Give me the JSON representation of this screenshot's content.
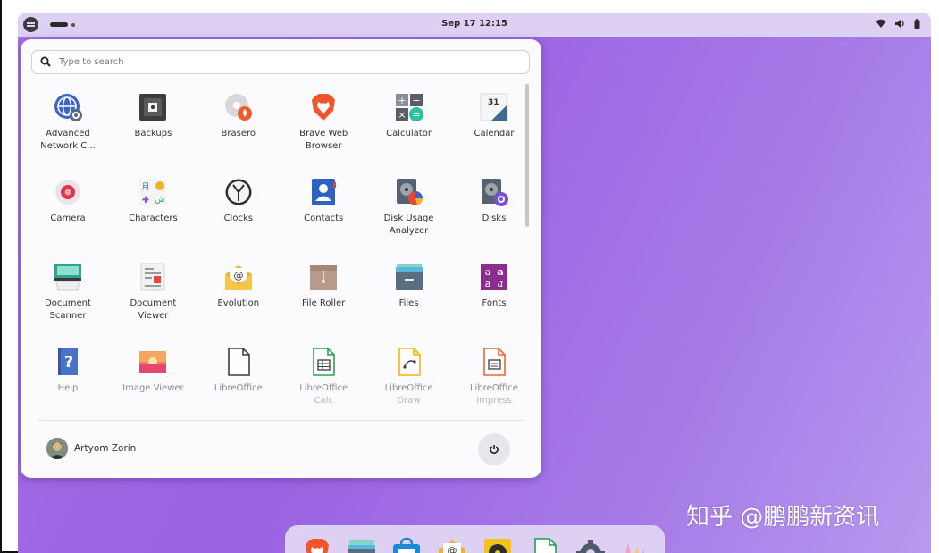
{
  "topbar": {
    "clock": "Sep 17  12:15",
    "workspaces": {
      "active": 1,
      "count": 2
    },
    "tray_icons": [
      "wifi-icon",
      "volume-icon",
      "battery-icon"
    ]
  },
  "menu": {
    "search_placeholder": "Type to search",
    "apps": [
      {
        "name": "Advanced",
        "sub": "Network C...",
        "icon": "network-settings-icon",
        "faded": false
      },
      {
        "name": "Backups",
        "sub": "",
        "icon": "backups-icon",
        "faded": false
      },
      {
        "name": "Brasero",
        "sub": "",
        "icon": "disc-burner-icon",
        "faded": false
      },
      {
        "name": "Brave Web",
        "sub": "Browser",
        "icon": "brave-lion-icon",
        "faded": false
      },
      {
        "name": "Calculator",
        "sub": "",
        "icon": "calculator-icon",
        "faded": false
      },
      {
        "name": "Calendar",
        "sub": "",
        "icon": "calendar-icon",
        "faded": false
      },
      {
        "name": "Camera",
        "sub": "",
        "icon": "camera-icon",
        "faded": false
      },
      {
        "name": "Characters",
        "sub": "",
        "icon": "characters-icon",
        "faded": false
      },
      {
        "name": "Clocks",
        "sub": "",
        "icon": "clock-icon",
        "faded": false
      },
      {
        "name": "Contacts",
        "sub": "",
        "icon": "contacts-icon",
        "faded": false
      },
      {
        "name": "Disk Usage",
        "sub": "Analyzer",
        "icon": "disk-usage-icon",
        "faded": false
      },
      {
        "name": "Disks",
        "sub": "",
        "icon": "disks-icon",
        "faded": false
      },
      {
        "name": "Document",
        "sub": "Scanner",
        "icon": "scanner-icon",
        "faded": false
      },
      {
        "name": "Document",
        "sub": "Viewer",
        "icon": "document-viewer-icon",
        "faded": false
      },
      {
        "name": "Evolution",
        "sub": "",
        "icon": "mail-envelope-icon",
        "faded": false
      },
      {
        "name": "File Roller",
        "sub": "",
        "icon": "archive-box-icon",
        "faded": false
      },
      {
        "name": "Files",
        "sub": "",
        "icon": "file-cabinet-icon",
        "faded": false
      },
      {
        "name": "Fonts",
        "sub": "",
        "icon": "fonts-icon",
        "faded": false
      },
      {
        "name": "Help",
        "sub": "",
        "icon": "help-book-icon",
        "faded": true
      },
      {
        "name": "Image Viewer",
        "sub": "",
        "icon": "image-viewer-icon",
        "faded": true
      },
      {
        "name": "LibreOffice",
        "sub": "",
        "icon": "libreoffice-icon",
        "faded": true
      },
      {
        "name": "LibreOffice",
        "sub": "Calc",
        "icon": "libreoffice-calc-icon",
        "faded": true
      },
      {
        "name": "LibreOffice",
        "sub": "Draw",
        "icon": "libreoffice-draw-icon",
        "faded": true
      },
      {
        "name": "LibreOffice",
        "sub": "Impress",
        "icon": "libreoffice-impress-icon",
        "faded": true
      }
    ],
    "user_name": "Artyom Zorin"
  },
  "dock": {
    "items": [
      "brave-lion-icon",
      "files-icon",
      "software-store-icon",
      "mail-icon",
      "music-icon",
      "document-icon",
      "settings-gear-icon",
      "office-icon"
    ]
  },
  "watermark": "知乎 @鹏鹏新资讯",
  "colors": {
    "wallpaper": "#9b62e2",
    "topbar": "#ddd0f3",
    "menu_bg": "#fbfafc"
  }
}
